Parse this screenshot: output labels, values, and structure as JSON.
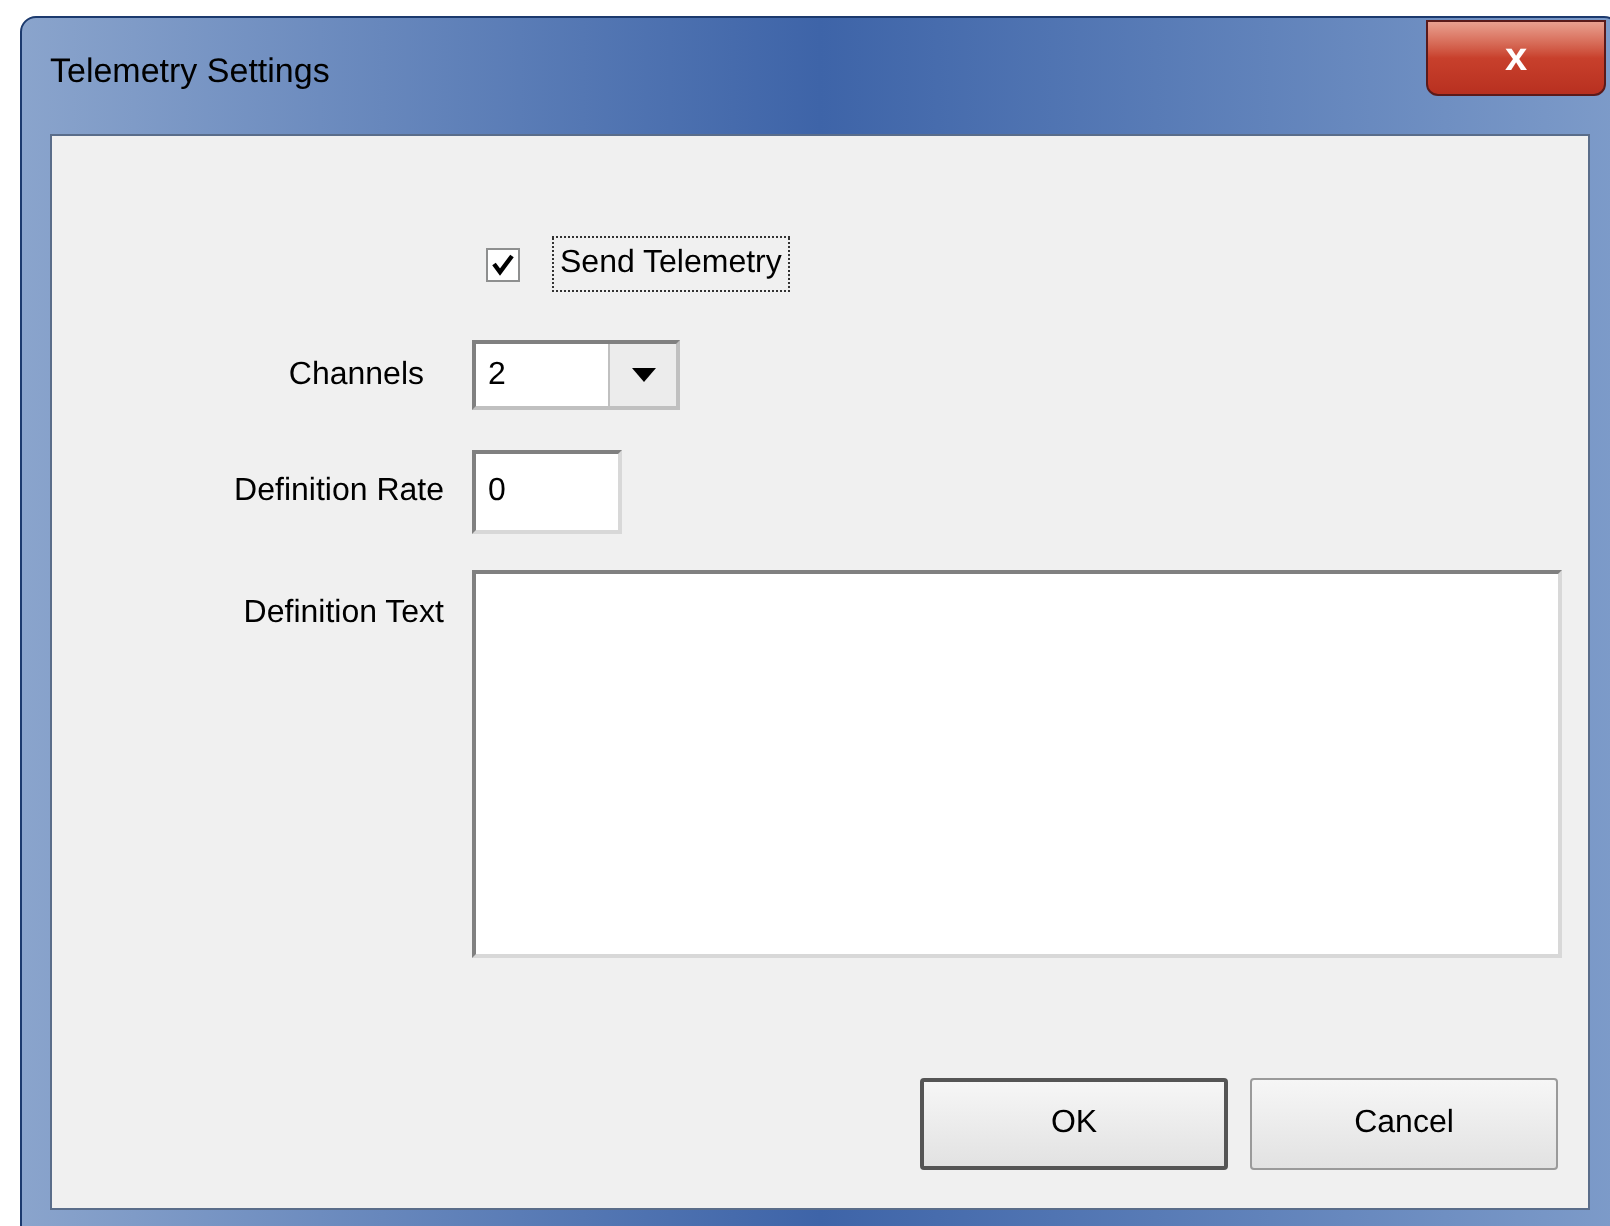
{
  "window": {
    "title": "Telemetry Settings",
    "close": "x"
  },
  "send_telemetry": {
    "label": "Send Telemetry",
    "checked": true,
    "focused": true
  },
  "channels": {
    "label": "Channels",
    "value": "2"
  },
  "definition_rate": {
    "label": "Definition Rate",
    "value": "0"
  },
  "definition_text": {
    "label": "Definition Text"
  },
  "buttons": [
    {
      "label": "OK",
      "default": true
    },
    {
      "label": "Cancel",
      "default": false
    }
  ]
}
